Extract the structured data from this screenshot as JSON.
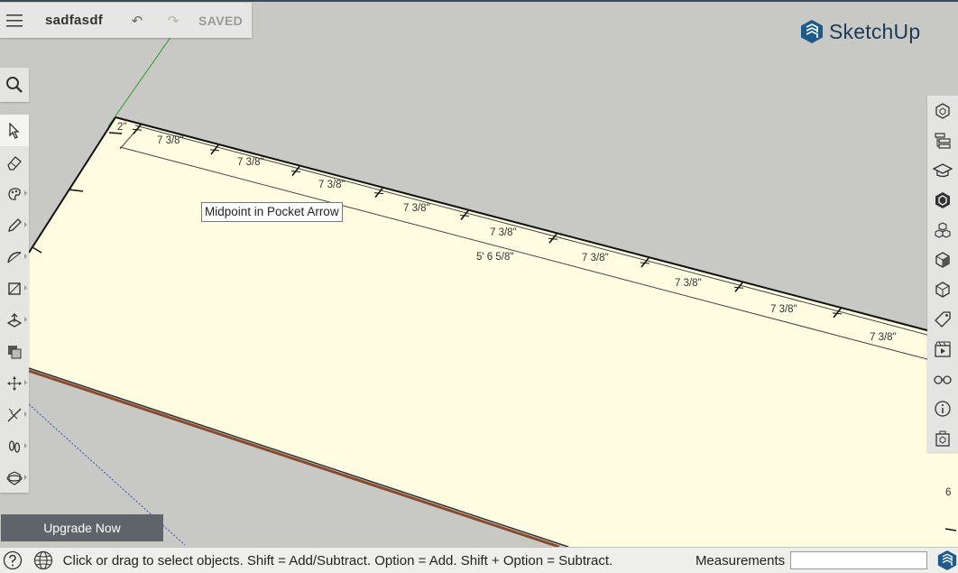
{
  "document": {
    "title": "sadfasdf",
    "save_status": "SAVED"
  },
  "brand": {
    "name": "SketchUp",
    "color": "#1d5b8c"
  },
  "toolbar": {
    "search_icon": "search-icon",
    "tools": [
      {
        "name": "select",
        "icon": "arrow-cursor-icon",
        "active": true
      },
      {
        "name": "eraser",
        "icon": "eraser-icon"
      },
      {
        "name": "paint",
        "icon": "paint-bucket-icon"
      },
      {
        "name": "pencil",
        "icon": "pencil-icon"
      },
      {
        "name": "arc",
        "icon": "arc-icon"
      },
      {
        "name": "rectangle",
        "icon": "rectangle-icon"
      },
      {
        "name": "push-pull",
        "icon": "push-pull-icon"
      },
      {
        "name": "offset",
        "icon": "offset-icon"
      },
      {
        "name": "move",
        "icon": "move-icon"
      },
      {
        "name": "tape-measure",
        "icon": "tape-measure-icon"
      },
      {
        "name": "walk",
        "icon": "footprints-icon"
      },
      {
        "name": "orbit",
        "icon": "orbit-icon"
      }
    ]
  },
  "right_panel": [
    "entity-info-icon",
    "outliner-icon",
    "instructor-icon",
    "components-icon",
    "materials-icon",
    "styles-icon",
    "views-icon",
    "tags-icon",
    "scenes-icon",
    "display-icon",
    "info-icon",
    "3d-warehouse-icon"
  ],
  "viewport": {
    "tooltip": "Midpoint in Pocket Arrow",
    "dimensions": [
      "7 3/8\"",
      "7 3/8\"",
      "7 3/8\"",
      "7 3/8\"",
      "7 3/8\"",
      "7 3/8\"",
      "7 3/8\"",
      "7 3/8\"",
      "7 3/8\""
    ],
    "total_dimension": "5' 6 5/8\"",
    "corner_dimension": "2\"",
    "edge_label": "6",
    "face_color": "#fefde1",
    "background_color": "#c8c8c5"
  },
  "upgrade_button": "Upgrade Now",
  "status_bar": {
    "message": "Click or drag to select objects. Shift = Add/Subtract. Option = Add. Shift + Option = Subtract.",
    "measurements_label": "Measurements",
    "measurements_value": ""
  }
}
